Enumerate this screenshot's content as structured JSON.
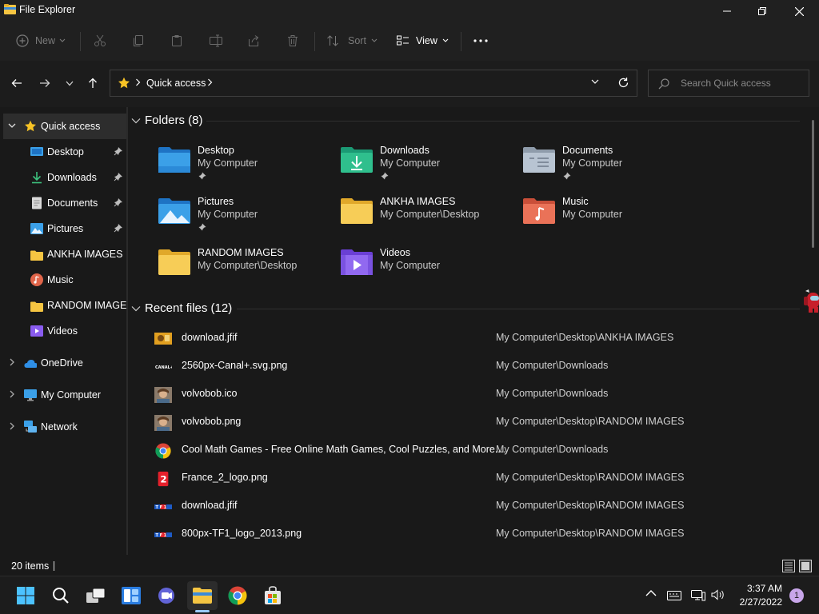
{
  "window": {
    "title": "File Explorer"
  },
  "toolbar": {
    "new_label": "New",
    "sort_label": "Sort",
    "view_label": "View"
  },
  "address": {
    "location": "Quick access",
    "search_placeholder": "Search Quick access"
  },
  "sidebar": {
    "quick_access": "Quick access",
    "items": [
      {
        "label": "Desktop",
        "icon": "desktop-icon",
        "pinned": true
      },
      {
        "label": "Downloads",
        "icon": "downloads-icon",
        "pinned": true
      },
      {
        "label": "Documents",
        "icon": "documents-icon",
        "pinned": true
      },
      {
        "label": "Pictures",
        "icon": "pictures-icon",
        "pinned": true
      },
      {
        "label": "ANKHA IMAGES",
        "icon": "folder-icon",
        "pinned": false
      },
      {
        "label": "Music",
        "icon": "music-icon",
        "pinned": false
      },
      {
        "label": "RANDOM IMAGES",
        "icon": "folder-icon",
        "pinned": false
      },
      {
        "label": "Videos",
        "icon": "videos-icon",
        "pinned": false
      }
    ],
    "roots": [
      {
        "label": "OneDrive",
        "icon": "onedrive-icon"
      },
      {
        "label": "My Computer",
        "icon": "computer-icon"
      },
      {
        "label": "Network",
        "icon": "network-icon"
      }
    ]
  },
  "main": {
    "folders_heading": "Folders (8)",
    "folders": [
      {
        "name": "Desktop",
        "location": "My Computer",
        "pinned": true,
        "icon": "desktop-folder-icon"
      },
      {
        "name": "Downloads",
        "location": "My Computer",
        "pinned": true,
        "icon": "downloads-folder-icon"
      },
      {
        "name": "Documents",
        "location": "My Computer",
        "pinned": true,
        "icon": "documents-folder-icon"
      },
      {
        "name": "Pictures",
        "location": "My Computer",
        "pinned": true,
        "icon": "pictures-folder-icon"
      },
      {
        "name": "ANKHA IMAGES",
        "location": "My Computer\\Desktop",
        "pinned": false,
        "icon": "folder-icon"
      },
      {
        "name": "Music",
        "location": "My Computer",
        "pinned": false,
        "icon": "music-folder-icon"
      },
      {
        "name": "RANDOM IMAGES",
        "location": "My Computer\\Desktop",
        "pinned": false,
        "icon": "folder-icon"
      },
      {
        "name": "Videos",
        "location": "My Computer",
        "pinned": false,
        "icon": "videos-folder-icon"
      }
    ],
    "recent_heading": "Recent files (12)",
    "recent": [
      {
        "name": "download.jfif",
        "location": "My Computer\\Desktop\\ANKHA IMAGES",
        "icon": "image-thumb-icon"
      },
      {
        "name": "2560px-Canal+.svg.png",
        "location": "My Computer\\Downloads",
        "icon": "canal-logo-icon"
      },
      {
        "name": "volvobob.ico",
        "location": "My Computer\\Downloads",
        "icon": "photo-thumb-icon"
      },
      {
        "name": "volvobob.png",
        "location": "My Computer\\Desktop\\RANDOM IMAGES",
        "icon": "photo-thumb-icon"
      },
      {
        "name": "Cool Math Games - Free Online Math Games, Cool Puzzles, and More....",
        "location": "My Computer\\Downloads",
        "icon": "chrome-icon"
      },
      {
        "name": "France_2_logo.png",
        "location": "My Computer\\Desktop\\RANDOM IMAGES",
        "icon": "france2-logo-icon"
      },
      {
        "name": "download.jfif",
        "location": "My Computer\\Desktop\\RANDOM IMAGES",
        "icon": "tf1-logo-icon"
      },
      {
        "name": "800px-TF1_logo_2013.png",
        "location": "My Computer\\Desktop\\RANDOM IMAGES",
        "icon": "tf1-logo-icon"
      }
    ]
  },
  "status": {
    "items_count": "20 items"
  },
  "taskbar": {
    "time": "3:37 AM",
    "date": "2/27/2022",
    "notifications": "1"
  },
  "colors": {
    "folder_yellow": "#f5c542",
    "accent": "#4cc2ff",
    "background": "#191919"
  }
}
